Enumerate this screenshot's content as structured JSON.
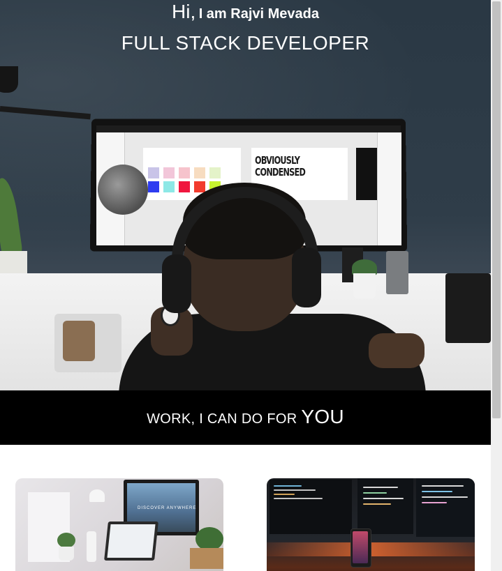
{
  "hero": {
    "hi": "Hi,",
    "intro": "I am Rajvi Mevada",
    "role": "FULL STACK DEVELOPER",
    "screen_text_1": "OBVIOUSLY",
    "screen_text_2": "CONDENSED"
  },
  "work": {
    "text": "WORK, I CAN DO FOR",
    "emphasis": "YOU"
  },
  "cards": {
    "left_monitor_text": "DISCOVER ANYWHERE"
  },
  "colors": {
    "band_background": "#000000",
    "page_background": "#ffffff",
    "hero_text": "#ffffff"
  }
}
